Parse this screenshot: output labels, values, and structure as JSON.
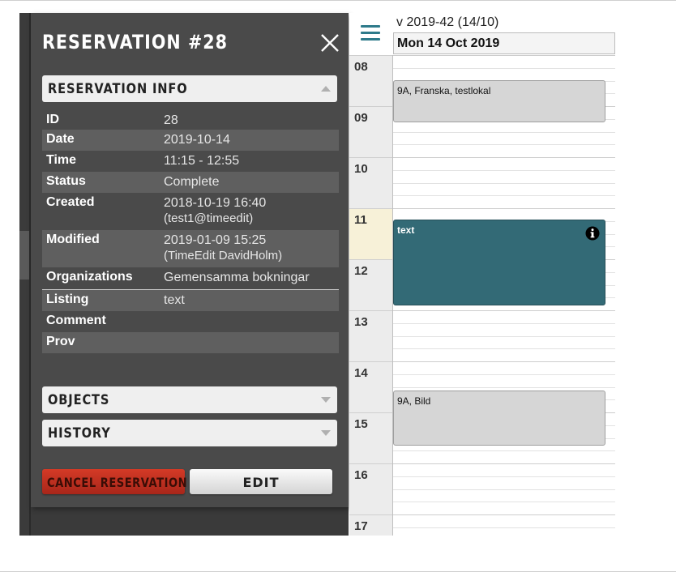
{
  "panel": {
    "title": "RESERVATION #28",
    "sections": {
      "info": "RESERVATION INFO",
      "objects": "OBJECTS",
      "history": "HISTORY"
    },
    "rows": [
      {
        "key": "ID",
        "value": "28"
      },
      {
        "key": "Date",
        "value": "2019-10-14"
      },
      {
        "key": "Time",
        "value": "11:15 - 12:55"
      },
      {
        "key": "Status",
        "value": "Complete"
      },
      {
        "key": "Created",
        "value": "2018-10-19 16:40",
        "sub": "(test1@timeedit)"
      },
      {
        "key": "Modified",
        "value": "2019-01-09 15:25",
        "sub": "(TimeEdit DavidHolm)"
      },
      {
        "key": "Organizations",
        "value": "Gemensamma bokningar"
      },
      {
        "key": "Listing",
        "value": "text"
      },
      {
        "key": "Comment",
        "value": ""
      },
      {
        "key": "Prov",
        "value": ""
      }
    ],
    "buttons": {
      "cancel": "CANCEL RESERVATION",
      "edit": "EDIT"
    }
  },
  "calendar": {
    "week": "v 2019-42 (14/10)",
    "day": "Mon 14 Oct 2019",
    "hours": [
      "08",
      "09",
      "10",
      "11",
      "12",
      "13",
      "14",
      "15",
      "16",
      "17"
    ],
    "current_hour": "11",
    "events": [
      {
        "label": "9A, Franska, testlokal",
        "style": "grey"
      },
      {
        "label": "text",
        "style": "teal",
        "icon": "info-icon"
      },
      {
        "label": "9A, Bild",
        "style": "grey"
      }
    ]
  },
  "colors": {
    "panel_bg": "#4a4a4a",
    "accent_teal": "#336a76",
    "cancel_red": "#c0301f",
    "menu_teal": "#2e7a8a"
  }
}
